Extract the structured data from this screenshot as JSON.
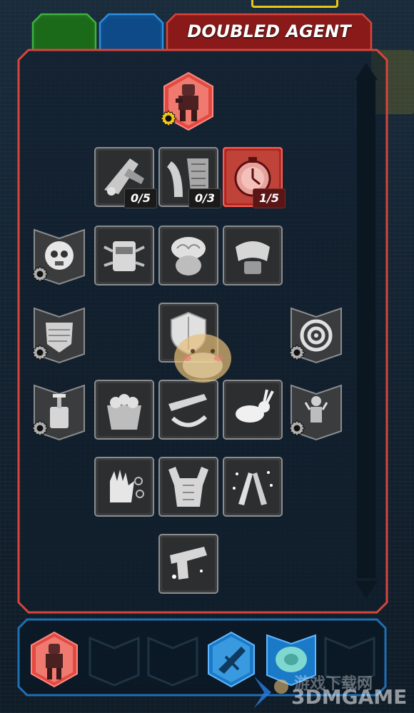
{
  "tabs": [
    {
      "id": "green",
      "label": "",
      "color": "#1f7a1f",
      "active": false
    },
    {
      "id": "blue",
      "label": "",
      "color": "#135aa0",
      "active": false
    },
    {
      "id": "red",
      "label": "DOUBLED AGENT",
      "color": "#8a1c1c",
      "active": true
    }
  ],
  "skill_tree": {
    "capstone_icon": "agent-portrait-icon",
    "tier2": [
      {
        "name": "sniper-rifle-skill",
        "count": "0/5",
        "active": false
      },
      {
        "name": "armored-plate-skill",
        "count": "0/3",
        "active": true
      },
      {
        "name": "stopwatch-skill",
        "count": "1/5",
        "active": true,
        "highlight": true
      }
    ],
    "tier3": [
      "skull-burst-skill",
      "backpack-skill",
      "brain-skill",
      "shoulder-armor-skill"
    ],
    "tier4": [
      "shield-crack-skill",
      "shield-skill",
      "target-skill"
    ],
    "tier5": [
      "detonator-skill",
      "grenade-basket-skill",
      "rifle-swap-skill",
      "rabbit-skill",
      "soldier-spark-skill"
    ],
    "tier6": [
      "hand-skill",
      "torso-skill",
      "sparkle-arms-skill"
    ],
    "tier7": [
      "pistol-skill"
    ]
  },
  "loadout": {
    "slots": [
      "agent-portrait-slot",
      "empty-slot-1",
      "empty-slot-2",
      "gun-turret-slot",
      "drone-slot",
      "empty-slot-3"
    ]
  },
  "colors": {
    "red_accent": "#d33a32",
    "gear_yellow": "#f2c81b",
    "blue_accent": "#1e8ad8"
  },
  "watermark": {
    "text": "3DMGAME",
    "cn": "游戏下载网"
  }
}
